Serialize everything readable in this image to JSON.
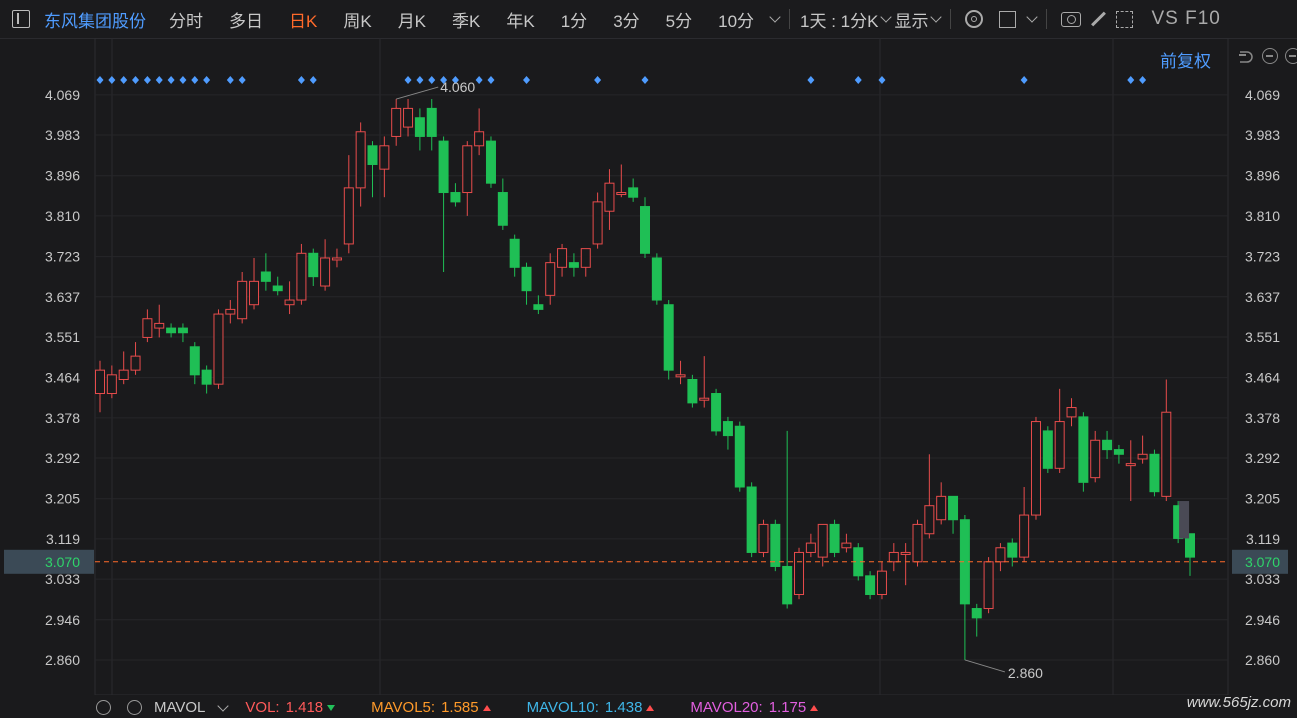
{
  "toolbar": {
    "stock_name": "东风集团股份",
    "periods": [
      "分时",
      "多日",
      "日K",
      "周K",
      "月K",
      "季K",
      "年K",
      "1分",
      "3分",
      "5分",
      "10分"
    ],
    "active_period": "日K",
    "range_select": "1天 : 1分K",
    "display_label": "显示",
    "vs_f10": "VS F10"
  },
  "chart_header": {
    "adjust_label": "前复权"
  },
  "axis": {
    "y_ticks": [
      "4.069",
      "3.983",
      "3.896",
      "3.810",
      "3.723",
      "3.637",
      "3.551",
      "3.464",
      "3.378",
      "3.292",
      "3.205",
      "3.119",
      "3.033",
      "2.946",
      "2.860"
    ],
    "current_price": "3.070",
    "high_label": "4.060",
    "low_label": "2.860"
  },
  "chart_data": {
    "type": "candlestick",
    "ylim": [
      2.8,
      4.12
    ],
    "y_ticks": [
      4.069,
      3.983,
      3.896,
      3.81,
      3.723,
      3.637,
      3.551,
      3.464,
      3.378,
      3.292,
      3.205,
      3.119,
      3.033,
      2.946,
      2.86
    ],
    "last_price": 3.07,
    "high": 4.06,
    "low": 2.86,
    "candles": [
      [
        3.43,
        3.48,
        3.5,
        3.39
      ],
      [
        3.43,
        3.47,
        3.49,
        3.42
      ],
      [
        3.46,
        3.48,
        3.52,
        3.45
      ],
      [
        3.48,
        3.51,
        3.54,
        3.47
      ],
      [
        3.55,
        3.59,
        3.61,
        3.54
      ],
      [
        3.57,
        3.58,
        3.62,
        3.55
      ],
      [
        3.57,
        3.56,
        3.58,
        3.55
      ],
      [
        3.57,
        3.56,
        3.58,
        3.54
      ],
      [
        3.53,
        3.47,
        3.54,
        3.45
      ],
      [
        3.48,
        3.45,
        3.49,
        3.43
      ],
      [
        3.45,
        3.6,
        3.61,
        3.44
      ],
      [
        3.6,
        3.61,
        3.63,
        3.58
      ],
      [
        3.59,
        3.67,
        3.69,
        3.58
      ],
      [
        3.62,
        3.67,
        3.72,
        3.61
      ],
      [
        3.69,
        3.67,
        3.73,
        3.65
      ],
      [
        3.66,
        3.65,
        3.68,
        3.64
      ],
      [
        3.62,
        3.63,
        3.67,
        3.6
      ],
      [
        3.63,
        3.73,
        3.75,
        3.62
      ],
      [
        3.73,
        3.68,
        3.74,
        3.66
      ],
      [
        3.66,
        3.72,
        3.76,
        3.65
      ],
      [
        3.72,
        3.72,
        3.74,
        3.7
      ],
      [
        3.75,
        3.87,
        3.94,
        3.73
      ],
      [
        3.87,
        3.99,
        4.01,
        3.83
      ],
      [
        3.96,
        3.92,
        3.97,
        3.85
      ],
      [
        3.91,
        3.96,
        3.98,
        3.85
      ],
      [
        3.98,
        4.04,
        4.06,
        3.96
      ],
      [
        4.0,
        4.04,
        4.06,
        3.98
      ],
      [
        4.02,
        3.98,
        4.04,
        3.95
      ],
      [
        4.04,
        3.98,
        4.06,
        3.95
      ],
      [
        3.97,
        3.86,
        3.98,
        3.69
      ],
      [
        3.86,
        3.84,
        3.88,
        3.83
      ],
      [
        3.86,
        3.96,
        3.97,
        3.81
      ],
      [
        3.96,
        3.99,
        4.04,
        3.94
      ],
      [
        3.97,
        3.88,
        3.98,
        3.87
      ],
      [
        3.86,
        3.79,
        3.89,
        3.78
      ],
      [
        3.76,
        3.7,
        3.77,
        3.68
      ],
      [
        3.7,
        3.65,
        3.71,
        3.62
      ],
      [
        3.62,
        3.61,
        3.64,
        3.6
      ],
      [
        3.64,
        3.71,
        3.73,
        3.62
      ],
      [
        3.7,
        3.74,
        3.75,
        3.68
      ],
      [
        3.71,
        3.7,
        3.73,
        3.68
      ],
      [
        3.7,
        3.74,
        3.74,
        3.68
      ],
      [
        3.75,
        3.84,
        3.86,
        3.74
      ],
      [
        3.82,
        3.88,
        3.91,
        3.78
      ],
      [
        3.86,
        3.86,
        3.92,
        3.85
      ],
      [
        3.87,
        3.85,
        3.89,
        3.84
      ],
      [
        3.83,
        3.73,
        3.85,
        3.72
      ],
      [
        3.72,
        3.63,
        3.73,
        3.62
      ],
      [
        3.62,
        3.48,
        3.63,
        3.46
      ],
      [
        3.47,
        3.47,
        3.5,
        3.45
      ],
      [
        3.46,
        3.41,
        3.47,
        3.4
      ],
      [
        3.42,
        3.42,
        3.51,
        3.4
      ],
      [
        3.43,
        3.35,
        3.44,
        3.34
      ],
      [
        3.37,
        3.34,
        3.38,
        3.31
      ],
      [
        3.36,
        3.23,
        3.37,
        3.22
      ],
      [
        3.23,
        3.09,
        3.24,
        3.08
      ],
      [
        3.09,
        3.15,
        3.16,
        3.08
      ],
      [
        3.15,
        3.06,
        3.16,
        3.05
      ],
      [
        3.06,
        2.98,
        3.35,
        2.97
      ],
      [
        3.0,
        3.09,
        3.1,
        2.99
      ],
      [
        3.09,
        3.11,
        3.13,
        3.08
      ],
      [
        3.08,
        3.15,
        3.15,
        3.06
      ],
      [
        3.15,
        3.09,
        3.16,
        3.08
      ],
      [
        3.1,
        3.11,
        3.13,
        3.09
      ],
      [
        3.1,
        3.04,
        3.11,
        3.03
      ],
      [
        3.04,
        3.0,
        3.05,
        2.99
      ],
      [
        3.0,
        3.05,
        3.07,
        2.99
      ],
      [
        3.07,
        3.09,
        3.11,
        3.05
      ],
      [
        3.09,
        3.09,
        3.11,
        3.02
      ],
      [
        3.07,
        3.15,
        3.16,
        3.06
      ],
      [
        3.13,
        3.19,
        3.3,
        3.12
      ],
      [
        3.16,
        3.21,
        3.24,
        3.15
      ],
      [
        3.21,
        3.16,
        3.21,
        3.13
      ],
      [
        3.16,
        2.98,
        3.17,
        2.86
      ],
      [
        2.97,
        2.95,
        2.98,
        2.91
      ],
      [
        2.97,
        3.07,
        3.08,
        2.96
      ],
      [
        3.07,
        3.1,
        3.11,
        3.05
      ],
      [
        3.11,
        3.08,
        3.12,
        3.06
      ],
      [
        3.08,
        3.17,
        3.23,
        3.07
      ],
      [
        3.17,
        3.37,
        3.38,
        3.16
      ],
      [
        3.35,
        3.27,
        3.36,
        3.26
      ],
      [
        3.27,
        3.37,
        3.44,
        3.26
      ],
      [
        3.38,
        3.4,
        3.42,
        3.36
      ],
      [
        3.38,
        3.24,
        3.39,
        3.22
      ],
      [
        3.25,
        3.33,
        3.35,
        3.24
      ],
      [
        3.33,
        3.31,
        3.35,
        3.29
      ],
      [
        3.31,
        3.3,
        3.32,
        3.28
      ],
      [
        3.28,
        3.28,
        3.33,
        3.2
      ],
      [
        3.29,
        3.3,
        3.34,
        3.28
      ],
      [
        3.3,
        3.22,
        3.31,
        3.21
      ],
      [
        3.21,
        3.39,
        3.46,
        3.2
      ],
      [
        3.19,
        3.12,
        3.2,
        3.11
      ],
      [
        3.13,
        3.08,
        3.13,
        3.04
      ]
    ],
    "markers_x_indices": [
      0,
      1,
      2,
      3,
      4,
      5,
      6,
      7,
      8,
      9,
      11,
      12,
      17,
      18,
      26,
      27,
      28,
      29,
      30,
      32,
      33,
      36,
      42,
      46,
      60,
      64,
      66,
      78,
      87,
      88
    ]
  },
  "indicators": {
    "name": "MAVOL",
    "vol_label": "VOL:",
    "vol_value": "1.418",
    "mavol5_label": "MAVOL5:",
    "mavol5_value": "1.585",
    "mavol10_label": "MAVOL10:",
    "mavol10_value": "1.438",
    "mavol20_label": "MAVOL20:",
    "mavol20_value": "1.175"
  },
  "colors": {
    "up": "#e84c4c",
    "down": "#1fbf55",
    "marker": "#4f9cff",
    "price_line": "#ff6a2a",
    "ghost": "#4a4a55"
  },
  "watermark": "www.565jz.com"
}
